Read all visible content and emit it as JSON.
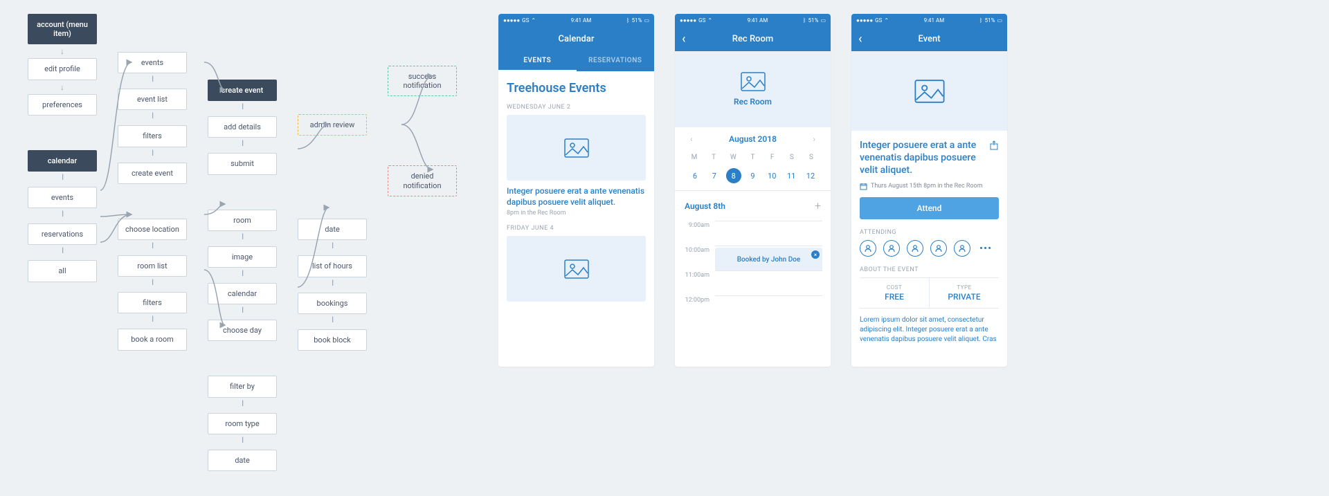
{
  "flow": {
    "col1a": [
      "account (menu item)",
      "edit profile",
      "preferences"
    ],
    "col1b": [
      "calendar",
      "events",
      "reservations",
      "all"
    ],
    "col2a": [
      "events",
      "event list",
      "filters",
      "create event"
    ],
    "col2b": [
      "choose location",
      "room list",
      "filters",
      "book a room"
    ],
    "col3a": [
      "create event",
      "add details",
      "submit"
    ],
    "col3b": [
      "room",
      "image",
      "calendar",
      "choose day"
    ],
    "col3c": [
      "filter by",
      "room type",
      "date"
    ],
    "col4a": [
      "admin review"
    ],
    "col4b": [
      "date",
      "list of hours",
      "bookings",
      "book block"
    ],
    "col5": [
      "success notification",
      "denied notification"
    ]
  },
  "status": {
    "carrier": "GS",
    "time": "9:41 AM",
    "battery": "51%"
  },
  "phone1": {
    "title": "Calendar",
    "tabA": "EVENTS",
    "tabB": "RESERVATIONS",
    "heading": "Treehouse Events",
    "date1": "WEDNESDAY JUNE 2",
    "card_title": "Integer posuere erat a ante venenatis dapibus posuere velit aliquet.",
    "card_sub": "8pm in the Rec Room",
    "date2": "FRIDAY JUNE 4"
  },
  "phone2": {
    "title": "Rec Room",
    "room_label": "Rec Room",
    "month": "August 2018",
    "dow": [
      "M",
      "T",
      "W",
      "T",
      "F",
      "S",
      "S"
    ],
    "days": [
      "6",
      "7",
      "8",
      "9",
      "10",
      "11",
      "12"
    ],
    "selected_index": 2,
    "date_head": "August 8th",
    "times": [
      "9:00am",
      "10:00am",
      "11:00am",
      "12:00pm"
    ],
    "booking": "Booked by John Doe"
  },
  "phone3": {
    "title": "Event",
    "event_title": "Integer posuere erat a ante venenatis dapibus posuere velit aliquet.",
    "event_meta": "Thurs August 15th 8pm in the Rec Room",
    "cta": "Attend",
    "attending_label": "ATTENDING",
    "about_label": "ABOUT THE EVENT",
    "cost_label": "COST",
    "cost_value": "FREE",
    "type_label": "TYPE",
    "type_value": "PRIVATE",
    "body": "Lorem ipsum dolor sit amet, consectetur adipiscing elit. Integer posuere erat a ante venenatis dapibus posuere velit aliquet. Cras"
  }
}
